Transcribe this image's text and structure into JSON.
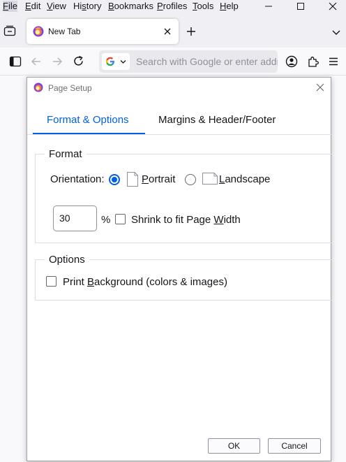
{
  "menubar": {
    "items": [
      {
        "label": "File",
        "key": "F",
        "rest": "ile"
      },
      {
        "label": "Edit",
        "key": "E",
        "rest": "dit"
      },
      {
        "label": "View",
        "key": "V",
        "rest": "iew"
      },
      {
        "label": "History",
        "key": "H",
        "pre": "Hi",
        "keyc": "s",
        "rest": "tory"
      },
      {
        "label": "Bookmarks",
        "key": "B",
        "rest": "ookmarks"
      },
      {
        "label": "Profiles",
        "key": "P",
        "rest": "rofiles"
      },
      {
        "label": "Tools",
        "key": "T",
        "rest": "ools"
      },
      {
        "label": "Help",
        "key": "H",
        "rest": "elp"
      }
    ]
  },
  "tab": {
    "title": "New Tab"
  },
  "urlbar": {
    "placeholder": "Search with Google or enter addr"
  },
  "dialog": {
    "title": "Page Setup",
    "tabs": [
      {
        "label": "Format & Options"
      },
      {
        "label": "Margins & Header/Footer"
      }
    ],
    "format": {
      "legend": "Format",
      "orientation_label": "Orientation:",
      "portrait_key": "P",
      "portrait_rest": "ortrait",
      "landscape_key": "L",
      "landscape_rest": "andscape",
      "orientation_selected": "Portrait",
      "scale_value": "30",
      "percent": "%",
      "shrink_pre": "Shrink to fit Page ",
      "shrink_key": "W",
      "shrink_rest": "idth",
      "shrink_checked": false
    },
    "options": {
      "legend": "Options",
      "print_bg_pre": "Print ",
      "print_bg_key": "B",
      "print_bg_rest": "ackground (colors & images)",
      "print_bg_checked": false
    },
    "ok_label": "OK",
    "cancel_label": "Cancel"
  },
  "colors": {
    "accent": "#0060df"
  }
}
